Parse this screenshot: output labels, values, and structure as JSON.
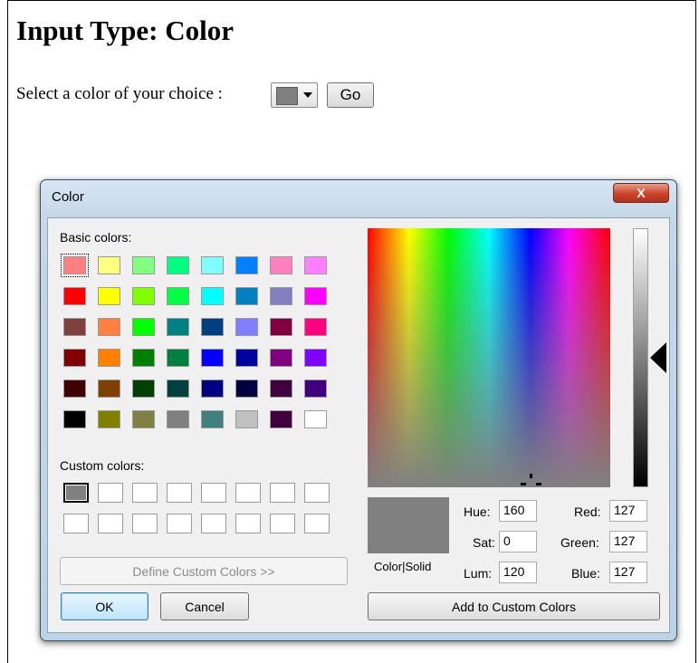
{
  "page": {
    "heading": "Input Type: Color",
    "prompt": "Select a color of your choice :",
    "color_value": "#808080",
    "go_label": "Go"
  },
  "dialog": {
    "title": "Color",
    "close_label": "X",
    "basic_colors_label": "Basic colors:",
    "custom_colors_label": "Custom colors:",
    "basic_colors": [
      [
        "#FF8080",
        "#FFFF80",
        "#80FF80",
        "#00FF80",
        "#80FFFF",
        "#0080FF",
        "#FF80C0",
        "#FF80FF"
      ],
      [
        "#FF0000",
        "#FFFF00",
        "#80FF00",
        "#00FF40",
        "#00FFFF",
        "#0080C0",
        "#8080C0",
        "#FF00FF"
      ],
      [
        "#804040",
        "#FF8040",
        "#00FF00",
        "#008080",
        "#004080",
        "#8080FF",
        "#800040",
        "#FF0080"
      ],
      [
        "#800000",
        "#FF8000",
        "#008000",
        "#008040",
        "#0000FF",
        "#0000A0",
        "#800080",
        "#8000FF"
      ],
      [
        "#400000",
        "#804000",
        "#004000",
        "#004040",
        "#000080",
        "#000040",
        "#400040",
        "#400080"
      ],
      [
        "#000000",
        "#808000",
        "#808040",
        "#808080",
        "#408080",
        "#C0C0C0",
        "#400040",
        "#FFFFFF"
      ]
    ],
    "custom_colors": [
      [
        "#808080",
        "#FFFFFF",
        "#FFFFFF",
        "#FFFFFF",
        "#FFFFFF",
        "#FFFFFF",
        "#FFFFFF",
        "#FFFFFF"
      ],
      [
        "#FFFFFF",
        "#FFFFFF",
        "#FFFFFF",
        "#FFFFFF",
        "#FFFFFF",
        "#FFFFFF",
        "#FFFFFF",
        "#FFFFFF"
      ]
    ],
    "define_custom_label": "Define Custom Colors >>",
    "ok_label": "OK",
    "cancel_label": "Cancel",
    "color_solid_label": "Color|Solid",
    "hue_label": "Hue:",
    "hue_value": "160",
    "sat_label": "Sat:",
    "sat_value": "0",
    "lum_label": "Lum:",
    "lum_value": "120",
    "red_label": "Red:",
    "red_value": "127",
    "green_label": "Green:",
    "green_value": "127",
    "blue_label": "Blue:",
    "blue_value": "127",
    "add_custom_label": "Add to Custom Colors",
    "preview_color": "#808080"
  }
}
